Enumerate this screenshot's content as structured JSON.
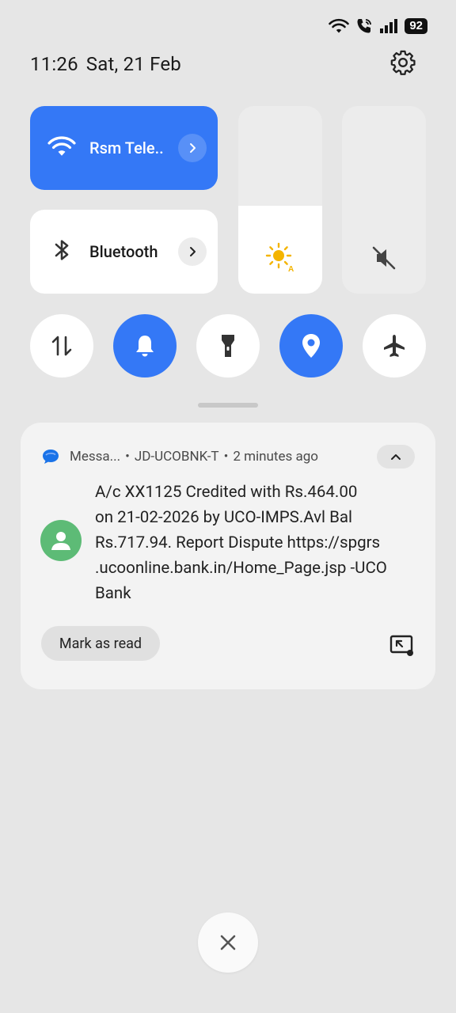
{
  "status_bar": {
    "battery": "92",
    "icons": [
      "wifi-icon",
      "wifi-call-icon",
      "signal-icon",
      "battery-icon"
    ]
  },
  "header": {
    "time": "11:26",
    "date": "Sat, 21 Feb",
    "settings_icon": "gear-icon"
  },
  "tiles": {
    "wifi": {
      "label": "Rsm Tele..",
      "icon": "wifi-icon",
      "active": true
    },
    "bluetooth": {
      "label": "Bluetooth",
      "icon": "bluetooth-icon",
      "active": false
    }
  },
  "sliders": {
    "brightness": {
      "level": 0.47,
      "icon": "brightness-auto-icon"
    },
    "volume": {
      "level": 0.0,
      "icon": "volume-muted-icon"
    }
  },
  "toggles": [
    {
      "name": "mobile-data",
      "icon": "data-arrows-icon",
      "active": false
    },
    {
      "name": "ring",
      "icon": "bell-icon",
      "active": true
    },
    {
      "name": "flashlight",
      "icon": "flashlight-icon",
      "active": false
    },
    {
      "name": "location",
      "icon": "location-icon",
      "active": true
    },
    {
      "name": "airplane",
      "icon": "airplane-icon",
      "active": false
    }
  ],
  "notification": {
    "app_name": "Messa...",
    "sender": "JD-UCOBNK-T",
    "time_ago": "2 minutes ago",
    "separator": "•",
    "lines": [
      "A/c XX1125 Credited with Rs.464.00",
      "on 21-02-2026 by UCO-IMPS.Avl Bal",
      "Rs.717.94. Report Dispute https://spgrs",
      ".ucoonline.bank.in/Home_Page.jsp -UCO",
      "Bank"
    ],
    "action_label": "Mark as read"
  },
  "colors": {
    "accent": "#3478f6",
    "background": "#e6e6e6",
    "avatar": "#5dbb76",
    "sun": "#f4b400"
  }
}
